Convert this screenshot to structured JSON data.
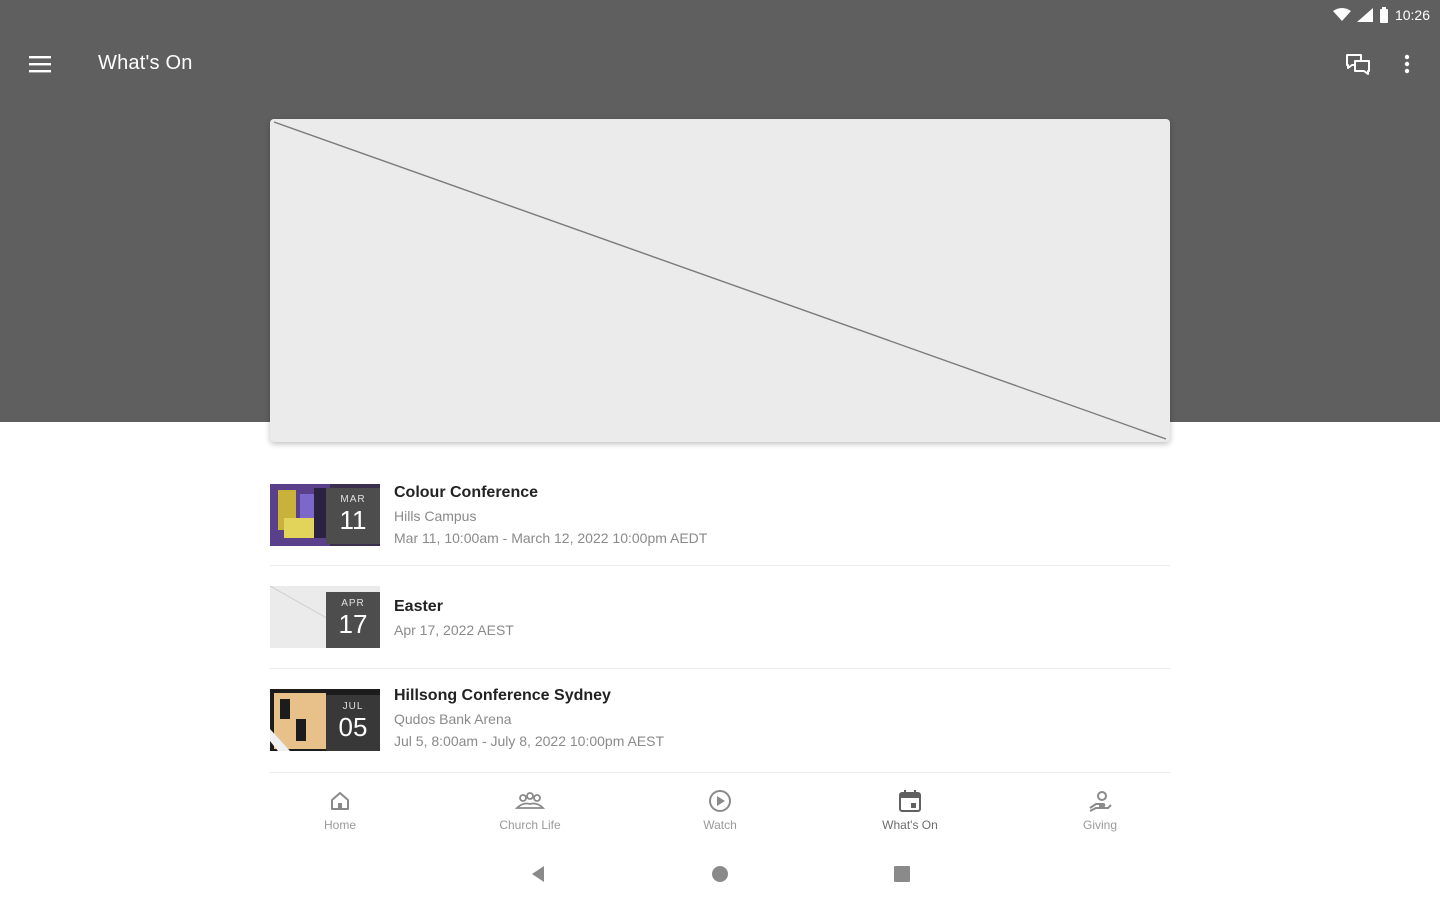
{
  "status_bar": {
    "time": "10:26",
    "icons": [
      "wifi-icon",
      "signal-icon",
      "battery-icon"
    ]
  },
  "toolbar": {
    "title": "What's On",
    "icons": {
      "menu": "hamburger-menu-icon",
      "chat": "chat-icon",
      "more": "more-vert-icon"
    }
  },
  "hero": {
    "image": "placeholder-image"
  },
  "events": [
    {
      "title": "Colour Conference",
      "location": "Hills Campus",
      "dates": "Mar 11, 10:00am - March 12, 2022 10:00pm AEDT",
      "month": "MAR",
      "day": "11",
      "thumb": "colour-conference-image"
    },
    {
      "title": "Easter",
      "location": "",
      "dates": "Apr 17, 2022 AEST",
      "month": "APR",
      "day": "17",
      "thumb": "placeholder-image"
    },
    {
      "title": "Hillsong Conference Sydney",
      "location": "Qudos Bank Arena",
      "dates": "Jul 5, 8:00am - July 8, 2022 10:00pm AEST",
      "month": "JUL",
      "day": "05",
      "thumb": "hillsong-conference-image"
    }
  ],
  "bottom_nav": [
    {
      "label": "Home",
      "icon": "home-icon"
    },
    {
      "label": "Church Life",
      "icon": "people-icon"
    },
    {
      "label": "Watch",
      "icon": "play-icon"
    },
    {
      "label": "What's On",
      "icon": "calendar-icon",
      "active": true
    },
    {
      "label": "Giving",
      "icon": "giving-icon"
    }
  ],
  "system_nav": [
    "back-icon",
    "home-circle-icon",
    "recents-icon"
  ],
  "colors": {
    "appbar": "#5f5f5f",
    "placeholder": "#ebebeb",
    "date_box": "#4d4d4d"
  }
}
